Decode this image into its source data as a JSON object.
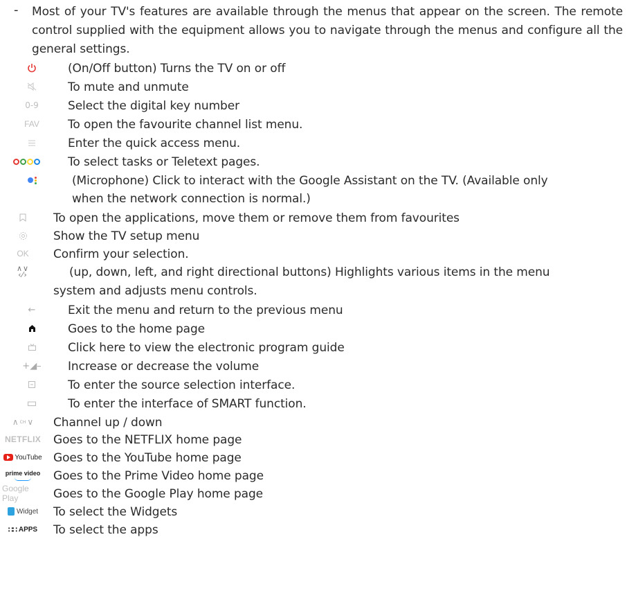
{
  "intro": {
    "dash": "-",
    "text": "Most of your TV's features are available through the menus that appear on the screen. The remote control supplied with the equipment allows you to navigate through the menus and configure all the general settings."
  },
  "items": [
    {
      "icon": "power-icon",
      "text": "(On/Off button) Turns the TV on or off"
    },
    {
      "icon": "mute-icon",
      "text": "To mute and unmute"
    },
    {
      "icon": "digit-keys-icon",
      "icon_text": "0-9",
      "text": "Select the digital key number"
    },
    {
      "icon": "fav-icon",
      "icon_text": "FAV",
      "text": "To open the favourite channel list menu."
    },
    {
      "icon": "menu-icon",
      "text": "Enter the quick access menu."
    },
    {
      "icon": "color-keys-icon",
      "text": "To select tasks or Teletext pages."
    },
    {
      "icon": "google-assistant-icon",
      "text": "(Microphone) Click to interact with the Google Assistant on the TV. (Available only",
      "text2": "when the network connection is normal.)"
    },
    {
      "icon": "bookmark-icon",
      "text": "To open the applications, move them or remove them from favourites"
    },
    {
      "icon": "settings-icon",
      "text": "Show the TV setup menu"
    },
    {
      "icon": "ok-icon",
      "icon_text": "OK",
      "text": "Confirm your selection."
    },
    {
      "icon": "directional-icon",
      "text": "(up, down, left, and right directional buttons) Highlights various items in the menu",
      "text2": "system and adjusts menu controls."
    },
    {
      "icon": "back-icon",
      "text": "Exit the menu and return to the previous menu"
    },
    {
      "icon": "home-icon",
      "text": "Goes to the home page"
    },
    {
      "icon": "guide-icon",
      "text": "Click here to view the electronic program guide"
    },
    {
      "icon": "volume-icon",
      "text": "Increase or decrease the volume"
    },
    {
      "icon": "source-icon",
      "text": "To enter the source selection interface."
    },
    {
      "icon": "smart-icon",
      "text": "To enter the interface of SMART function."
    },
    {
      "icon": "channel-icon",
      "icon_text": "CH",
      "text": "Channel up / down"
    },
    {
      "icon": "netflix-logo-icon",
      "icon_text": "NETFLIX",
      "text": "Goes to the NETFLIX home page"
    },
    {
      "icon": "youtube-logo-icon",
      "icon_text": "YouTube",
      "text": "Goes to the YouTube home page"
    },
    {
      "icon": "prime-video-logo-icon",
      "icon_text": "prime video",
      "text": "Goes to the Prime Video home page"
    },
    {
      "icon": "google-play-logo-icon",
      "icon_text": "Google Play",
      "text": "Goes to the Google Play home page"
    },
    {
      "icon": "widget-icon",
      "icon_text": "Widget",
      "text": "To select the Widgets"
    },
    {
      "icon": "apps-icon",
      "icon_text": "APPS",
      "text": "To select the apps"
    }
  ],
  "colors": {
    "text": "#2b2b2b",
    "power": "#e53935",
    "netflix": "#e50914",
    "youtube": "#e62117",
    "prime": "#1a98ff",
    "widget": "#2ea3e0",
    "dot_red": "#e53935",
    "dot_green": "#43a047",
    "dot_yellow": "#fdd835",
    "dot_blue": "#1e88e5"
  }
}
